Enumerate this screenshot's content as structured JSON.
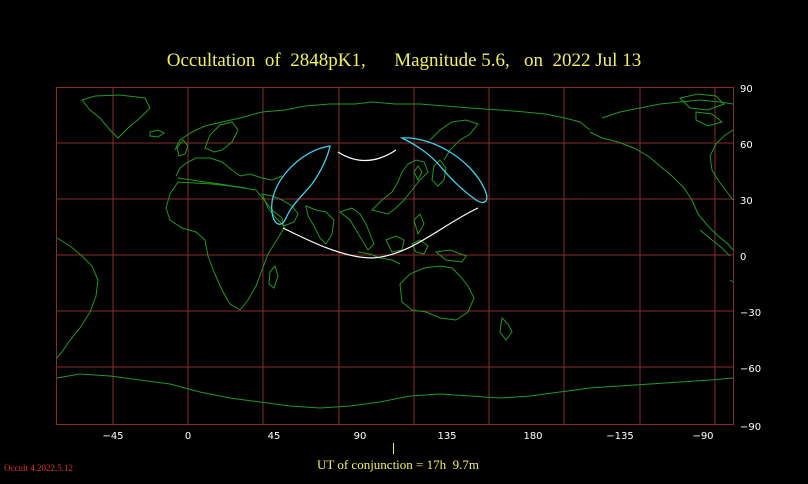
{
  "title": {
    "object": "Occultation  of  2848pK1,",
    "magnitude": "Magnitude 5.6,",
    "date": "on  2022 Jul 13"
  },
  "axes": {
    "longitude_labels": [
      "−45",
      "0",
      "45",
      "90",
      "135",
      "180",
      "−135",
      "−90"
    ],
    "latitude_labels": [
      "90",
      "60",
      "30",
      "0",
      "−30",
      "−60",
      "−90"
    ]
  },
  "conjunction": {
    "label": "UT of conjunction = 17h  9.7m"
  },
  "version": "Occult 4.2022.5.12",
  "colors": {
    "background": "#000000",
    "grid": "#8b2a2a",
    "coast": "#1f9a1f",
    "limit_line": "#ffffff",
    "graze_line": "#40d0f0",
    "title": "#f0f060",
    "version": "#e03030"
  }
}
